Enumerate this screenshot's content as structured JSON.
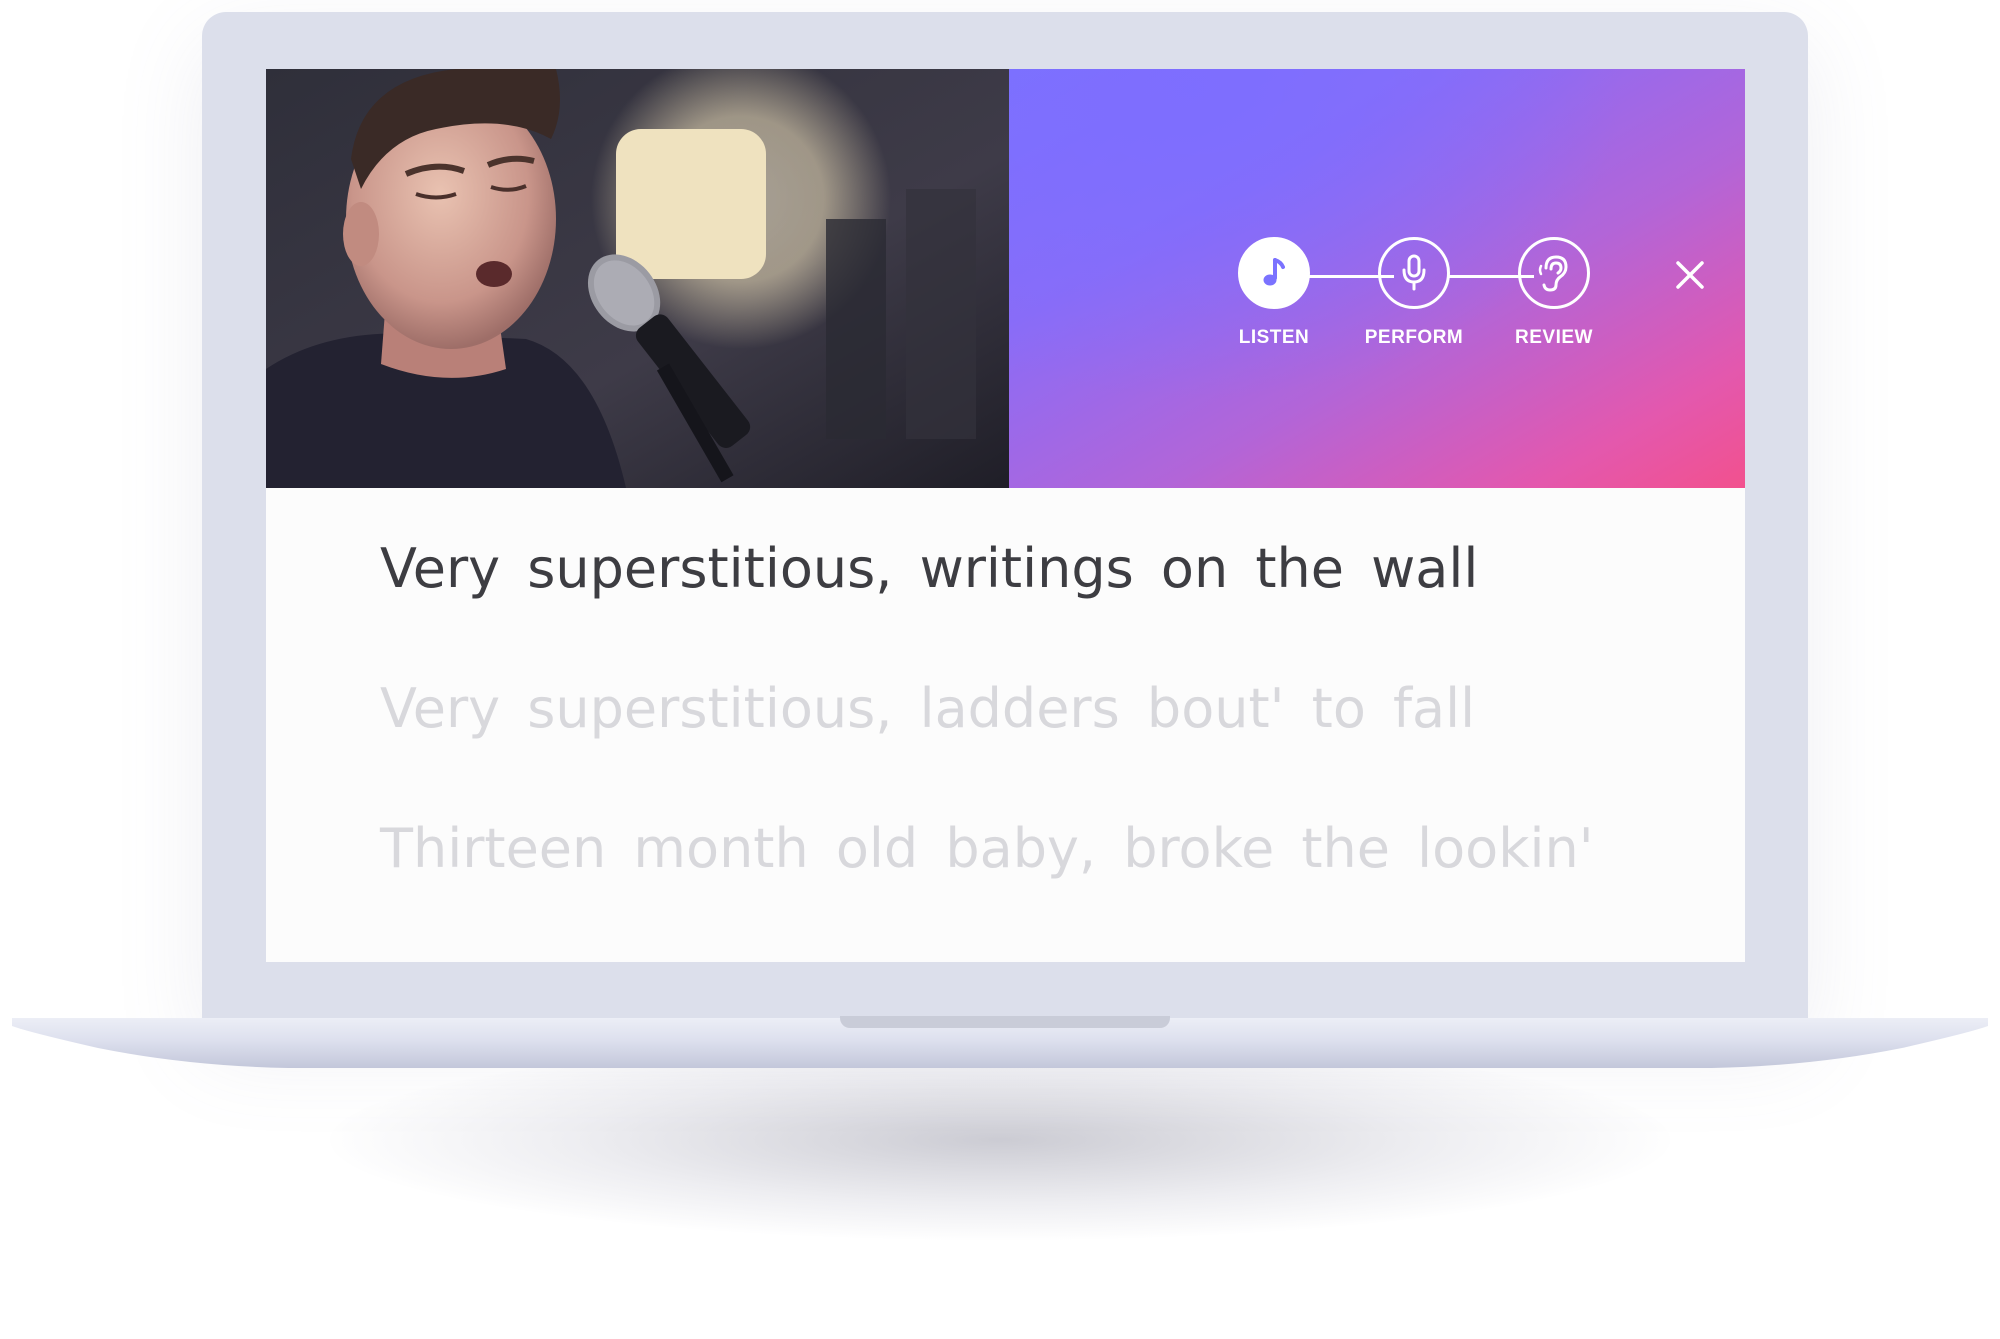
{
  "player": {
    "video": {
      "description_icon": "singer-video-thumbnail"
    },
    "steps": [
      {
        "label": "LISTEN",
        "icon": "music-note-icon",
        "active": true
      },
      {
        "label": "PERFORM",
        "icon": "microphone-icon",
        "active": false
      },
      {
        "label": "REVIEW",
        "icon": "ear-icon",
        "active": false
      }
    ],
    "close_icon": "close-icon"
  },
  "lyrics": {
    "current": "Very superstitious, writings on the wall",
    "next": "Very superstitious, ladders bout' to fall",
    "after": "Thirteen month old baby, broke the lookin'"
  },
  "colors": {
    "gradient_start": "#7b72ff",
    "gradient_end": "#f2518e",
    "active_icon": "#7b72ff",
    "lyric_current": "#3d3d42",
    "lyric_upcoming": "#d8d8dc"
  }
}
